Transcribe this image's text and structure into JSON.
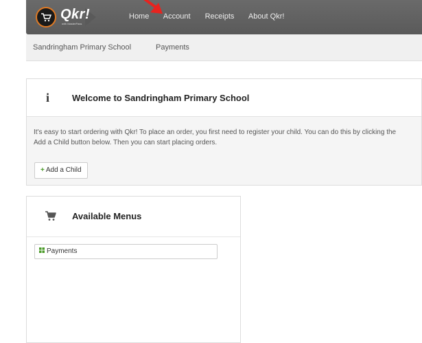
{
  "brand": {
    "name": "Qkr!",
    "tagline": "with MasterPass"
  },
  "nav": {
    "items": [
      "Home",
      "Account",
      "Receipts",
      "About Qkr!"
    ]
  },
  "breadcrumb": {
    "items": [
      "Sandringham Primary School",
      "Payments"
    ]
  },
  "welcome": {
    "icon": "info-icon",
    "title": "Welcome to Sandringham Primary School",
    "line1": "It's easy to start ordering with Qkr! To place an order, you first need to register your child. You can do this by clicking the",
    "line2": "Add a Child button below. Then you can start placing orders.",
    "add_child_label": "Add a Child"
  },
  "menus": {
    "icon": "cart-icon",
    "title": "Available Menus",
    "items": [
      "Payments"
    ]
  },
  "colors": {
    "topbar": "#5e5e5e",
    "accent_green": "#4b9b2a",
    "annotation_arrow": "#e8231f",
    "logo_ring": "#e07a24"
  }
}
